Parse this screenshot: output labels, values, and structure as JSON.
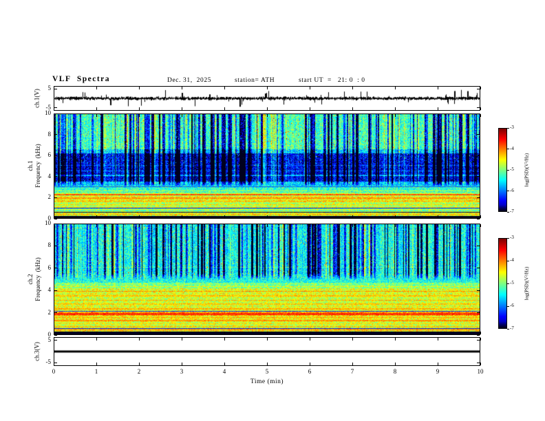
{
  "header": {
    "title": "VLF  Spectra",
    "date": "Dec. 31,  2025",
    "station": "station= ATH",
    "start_ut": "start UT  =   21: 0  : 0"
  },
  "x_axis": {
    "label": "Time  (min)",
    "tick_labels": [
      "0",
      "1",
      "2",
      "3",
      "4",
      "5",
      "6",
      "7",
      "8",
      "9",
      "10"
    ]
  },
  "panels": {
    "ch1_wave": {
      "ylabel": "ch.1(V)",
      "tick_labels": [
        "5",
        "-5"
      ]
    },
    "ch1_spec": {
      "ylabel": "ch.1\nFrequency  (kHz)",
      "tick_labels": [
        "10",
        "8",
        "6",
        "4",
        "2",
        "0"
      ]
    },
    "ch2_spec": {
      "ylabel": "ch.2\nFrequency  (kHz)",
      "tick_labels": [
        "10",
        "8",
        "6",
        "4",
        "2",
        "0"
      ]
    },
    "ch3_wave": {
      "ylabel": "ch.3(V)",
      "tick_labels": [
        "5",
        "-5"
      ]
    }
  },
  "colorbars": {
    "label": "log(PSD)(V²/Hz)",
    "tick_labels": [
      "-3",
      "-4",
      "-5",
      "-6",
      "-7"
    ]
  },
  "chart_data": [
    {
      "type": "line",
      "name": "ch.1 waveform",
      "ylabel": "ch.1(V)",
      "x_range_min": [
        0,
        10
      ],
      "y_range_V": [
        -5,
        5
      ],
      "baseline_V": 0,
      "noise_rms_V": 0.55,
      "spike_probability": 0.012,
      "spike_amplitude_V": [
        1.5,
        4.5
      ],
      "description": "Continuous broadband VLF time series fluctuating about 0 V (~±1 V) with frequent impulsive sferic spikes reaching toward ±5 V across the full 0–10 min record."
    },
    {
      "type": "heatmap",
      "name": "ch.1 spectrogram",
      "x_range_min": [
        0,
        10
      ],
      "y_range_kHz": [
        0,
        10
      ],
      "z_log_psd_range": [
        -7,
        -3
      ],
      "z_colormap": "jet",
      "noise_amp": 1.0,
      "bands": [
        [
          0,
          0.22,
          -7.6
        ],
        [
          0.22,
          0.5,
          -4.6
        ],
        [
          0.5,
          0.9,
          -5.1
        ],
        [
          0.9,
          1.5,
          -4.8
        ],
        [
          1.5,
          2.1,
          -4.5
        ],
        [
          2.1,
          2.45,
          -4.8
        ],
        [
          2.45,
          3.1,
          -5.3
        ],
        [
          3.1,
          3.5,
          -5.7
        ],
        [
          3.5,
          6.2,
          -6.5
        ],
        [
          6.2,
          6.6,
          -5.7
        ],
        [
          6.6,
          10.01,
          -5.25
        ]
      ],
      "lines": [
        [
          0.35,
          0.05,
          -4.2
        ],
        [
          0.62,
          0.04,
          -4.8
        ],
        [
          0.82,
          0.04,
          -4.6
        ],
        [
          1.05,
          0.04,
          -4.5
        ],
        [
          1.3,
          0.04,
          -4.4
        ],
        [
          1.62,
          0.05,
          -4.25
        ],
        [
          1.92,
          0.05,
          -4.1
        ],
        [
          2.27,
          0.06,
          -3.85
        ],
        [
          2.62,
          0.04,
          -4.7
        ],
        [
          4.1,
          0.04,
          -5.8
        ],
        [
          4.55,
          0.04,
          -6.0
        ],
        [
          5.05,
          0.03,
          -6.1
        ]
      ],
      "dark_lines": [
        [
          0.58,
          0.03,
          -6.9
        ],
        [
          0.98,
          0.03,
          -6.6
        ],
        [
          3.0,
          0.03,
          -6.2
        ]
      ],
      "streaks": {
        "f_min_kHz": 3.0,
        "dark_prob": 0.3,
        "bright_prob": 0.13
      },
      "description": "Black band near 0 kHz; bright yellow/green horizontal hum lines between ~0.3 and 2.6 kHz (orange line near 2.3 kHz); dark-blue quiet band ~3.5–6.2 kHz with faint cyan lines near 4.1/4.6/5.0 kHz; cyan-green speckled field 6.6–10 kHz crossed by dense dark vertical sferic streaks."
    },
    {
      "type": "heatmap",
      "name": "ch.2 spectrogram",
      "x_range_min": [
        0,
        10
      ],
      "y_range_kHz": [
        0,
        10
      ],
      "z_log_psd_range": [
        -7,
        -3
      ],
      "z_colormap": "jet",
      "noise_amp": 0.95,
      "bands": [
        [
          0,
          0.22,
          -7.6
        ],
        [
          0.22,
          0.6,
          -4.5
        ],
        [
          0.6,
          1.1,
          -4.7
        ],
        [
          1.1,
          1.7,
          -4.5
        ],
        [
          1.7,
          2.05,
          -4.15
        ],
        [
          2.05,
          2.6,
          -4.6
        ],
        [
          2.6,
          3.4,
          -4.7
        ],
        [
          3.4,
          4.2,
          -4.6
        ],
        [
          4.2,
          4.7,
          -5.0
        ],
        [
          4.7,
          5.5,
          -5.4
        ],
        [
          5.5,
          10.01,
          -5.5
        ]
      ],
      "lines": [
        [
          0.4,
          0.05,
          -3.9
        ],
        [
          0.72,
          0.04,
          -4.2
        ],
        [
          0.95,
          0.04,
          -4.4
        ],
        [
          1.25,
          0.04,
          -4.1
        ],
        [
          1.55,
          0.04,
          -4.2
        ],
        [
          1.87,
          0.09,
          -3.7
        ],
        [
          2.3,
          0.05,
          -4.2
        ],
        [
          2.75,
          0.04,
          -4.3
        ],
        [
          3.1,
          0.04,
          -4.2
        ],
        [
          3.5,
          0.04,
          -4.3
        ],
        [
          3.9,
          0.05,
          -4.1
        ],
        [
          4.35,
          0.04,
          -4.5
        ],
        [
          6.1,
          0.04,
          -5.2
        ],
        [
          7.0,
          0.03,
          -5.3
        ]
      ],
      "dark_lines": [
        [
          0.55,
          0.03,
          -6.6
        ],
        [
          2.12,
          0.03,
          -6.2
        ],
        [
          4.0,
          0.03,
          -5.9
        ]
      ],
      "streaks": {
        "f_min_kHz": 4.9,
        "dark_prob": 0.32,
        "bright_prob": 0.1
      },
      "description": "Black band near 0 kHz; intense yellow/orange horizontal interference striping from ~0.3 to 4.5 kHz (brightest band near 1.9 kHz); transition to green ~4.2–5.5 kHz; cyan field 5.5–10 kHz crossed by dense dark-blue vertical sferic streaks and scattered bright speckles."
    },
    {
      "type": "line",
      "name": "ch.3 waveform",
      "ylabel": "ch.3(V)",
      "x_range_min": [
        0,
        10
      ],
      "y_range_V": [
        -5,
        5
      ],
      "constant_V": 0,
      "description": "Completely flat thick trace at 0 V for the entire 0–10 min (channel inactive)."
    }
  ]
}
